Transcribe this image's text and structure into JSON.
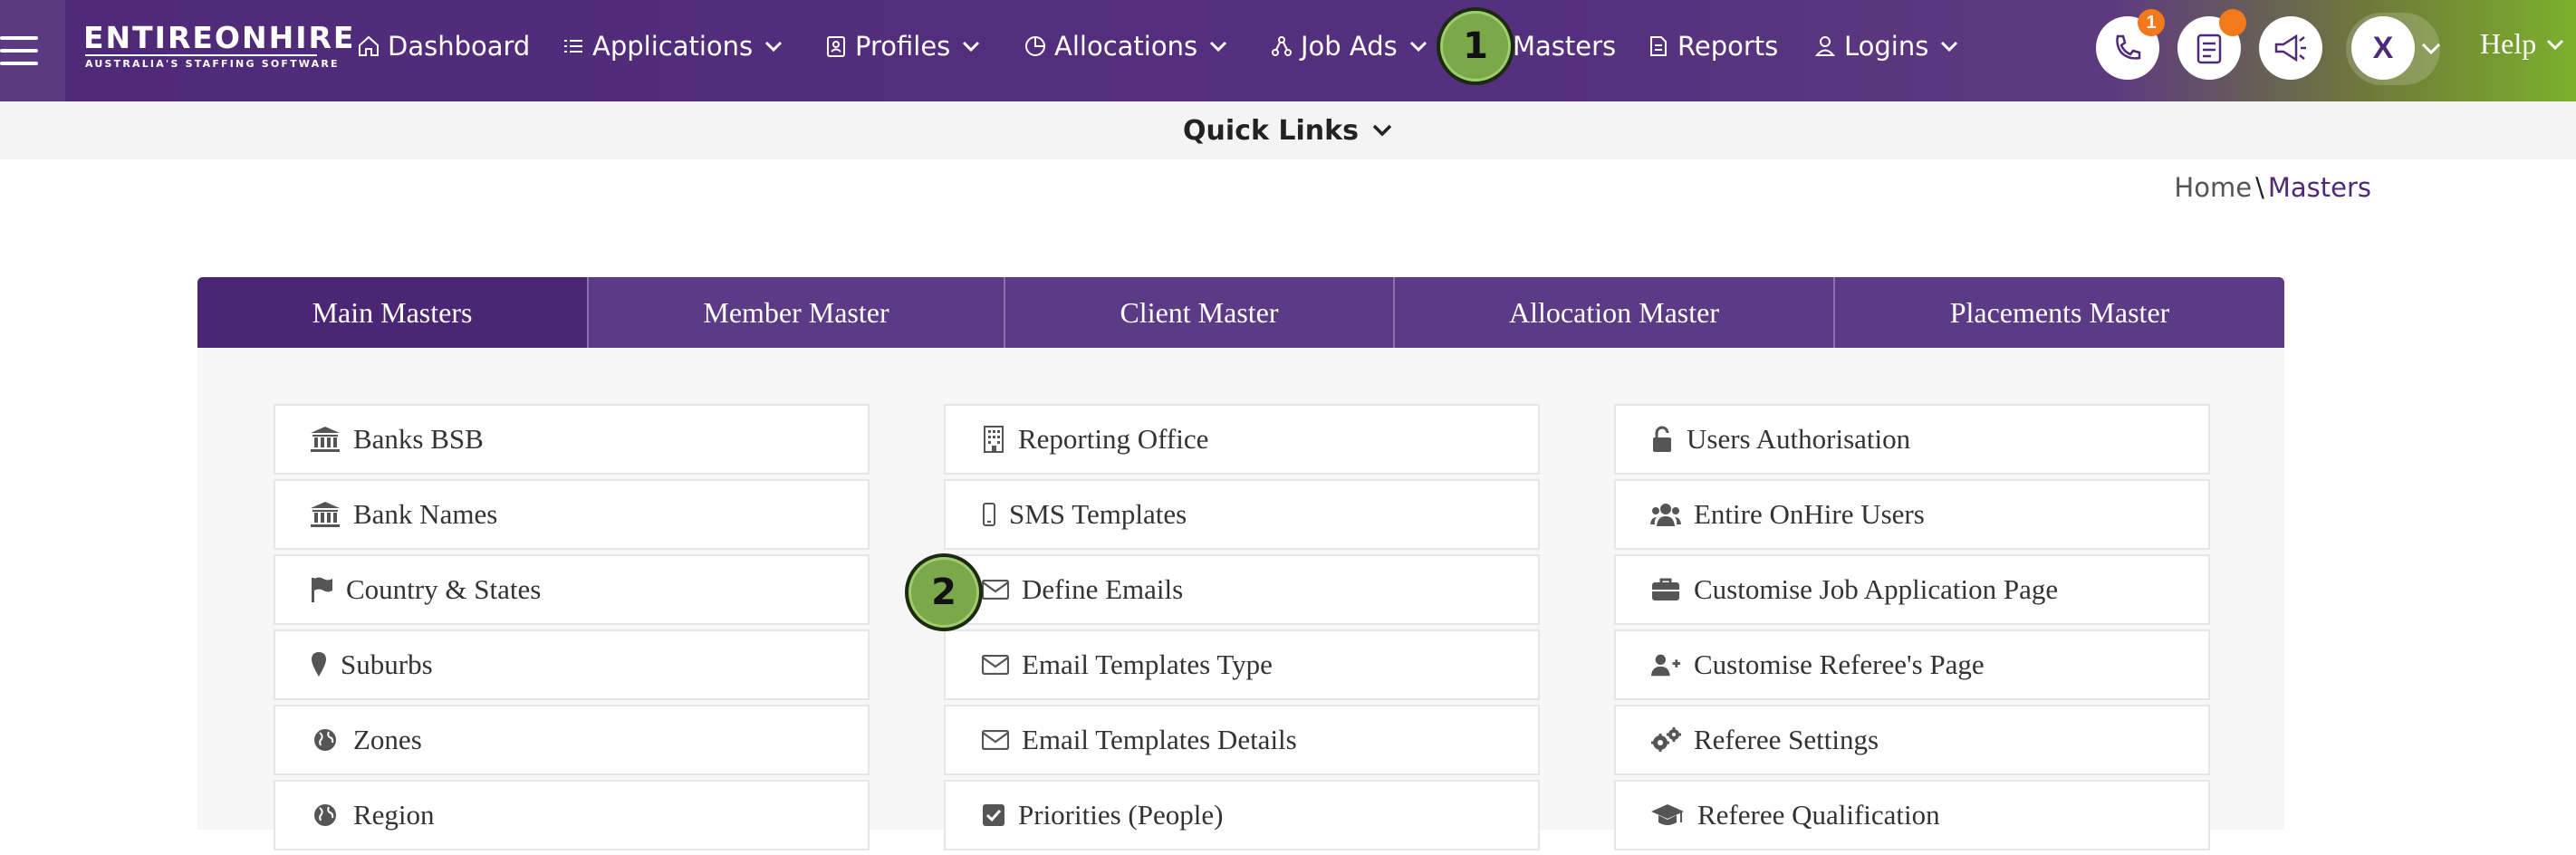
{
  "brand": {
    "name": "ENTIREONHIRE",
    "tagline": "AUSTRALIA'S STAFFING SOFTWARE"
  },
  "nav": {
    "dashboard": "Dashboard",
    "applications": "Applications",
    "profiles": "Profiles",
    "allocations": "Allocations",
    "job_ads": "Job Ads",
    "masters": "Masters",
    "reports": "Reports",
    "logins": "Logins",
    "help": "Help"
  },
  "header_actions": {
    "calls_badge": "1",
    "user_initial": "X"
  },
  "quick_links": "Quick Links",
  "breadcrumb": {
    "home": "Home",
    "separator": "\\",
    "current": "Masters"
  },
  "tabs": [
    "Main Masters",
    "Member Master",
    "Client Master",
    "Allocation Master",
    "Placements Master"
  ],
  "columns": {
    "left": [
      "Banks BSB",
      "Bank Names",
      "Country & States",
      "Suburbs",
      "Zones",
      "Region"
    ],
    "middle": [
      "Reporting Office",
      "SMS Templates",
      "Define Emails",
      "Email Templates Type",
      "Email Templates Details",
      "Priorities (People)"
    ],
    "right": [
      "Users Authorisation",
      "Entire OnHire Users",
      "Customise Job Application Page",
      "Customise Referee's Page",
      "Referee Settings",
      "Referee Qualification"
    ]
  },
  "markers": [
    "1",
    "2"
  ],
  "colors": {
    "primary": "#4f2a78",
    "accent_green": "#7bb02c",
    "badge": "#f27a1a",
    "marker": "#7aa84a"
  }
}
